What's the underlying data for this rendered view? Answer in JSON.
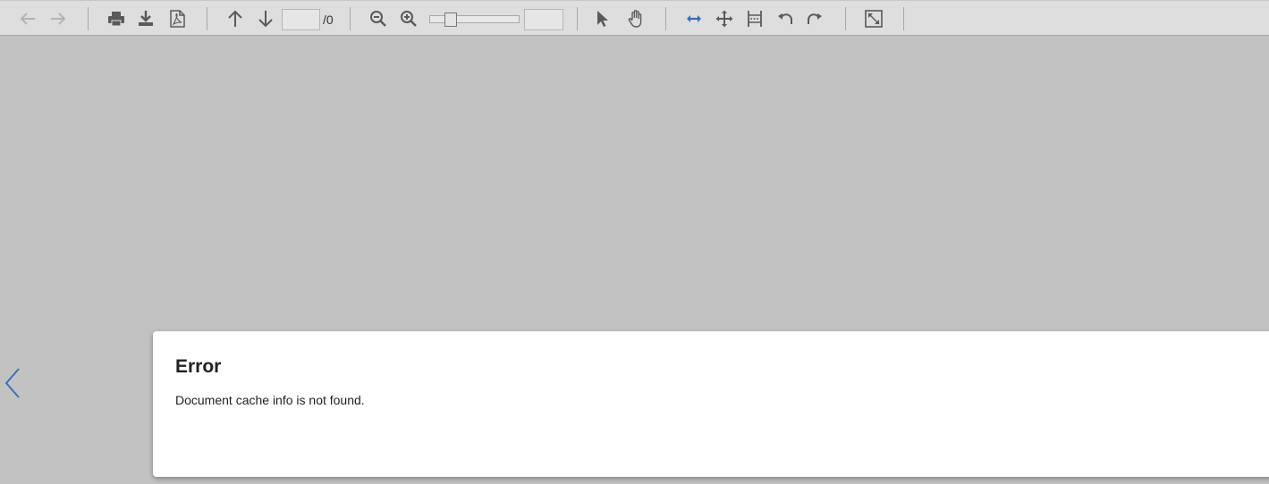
{
  "toolbar": {
    "page_number_value": "",
    "page_total": "/0",
    "zoom_value": "",
    "zoom_level": 0.2,
    "buttons": [
      "back-icon",
      "forward-icon",
      "print-icon",
      "download-icon",
      "pdf-icon",
      "arrow-up-icon",
      "arrow-down-icon",
      "zoom-out-icon",
      "zoom-in-icon",
      "pointer-icon",
      "hand-icon",
      "fit-width-icon",
      "move-icon",
      "fit-page-icon",
      "rotate-left-icon",
      "rotate-right-icon",
      "fullscreen-icon"
    ]
  },
  "dialog": {
    "title": "Error",
    "message": "Document cache info is not found."
  },
  "colors": {
    "canvas": "#c2c2c2",
    "toolbar": "#dedede",
    "icon": "#5a5a5a",
    "icon_disabled": "#b3b3b3",
    "accent": "#2e6fba"
  }
}
